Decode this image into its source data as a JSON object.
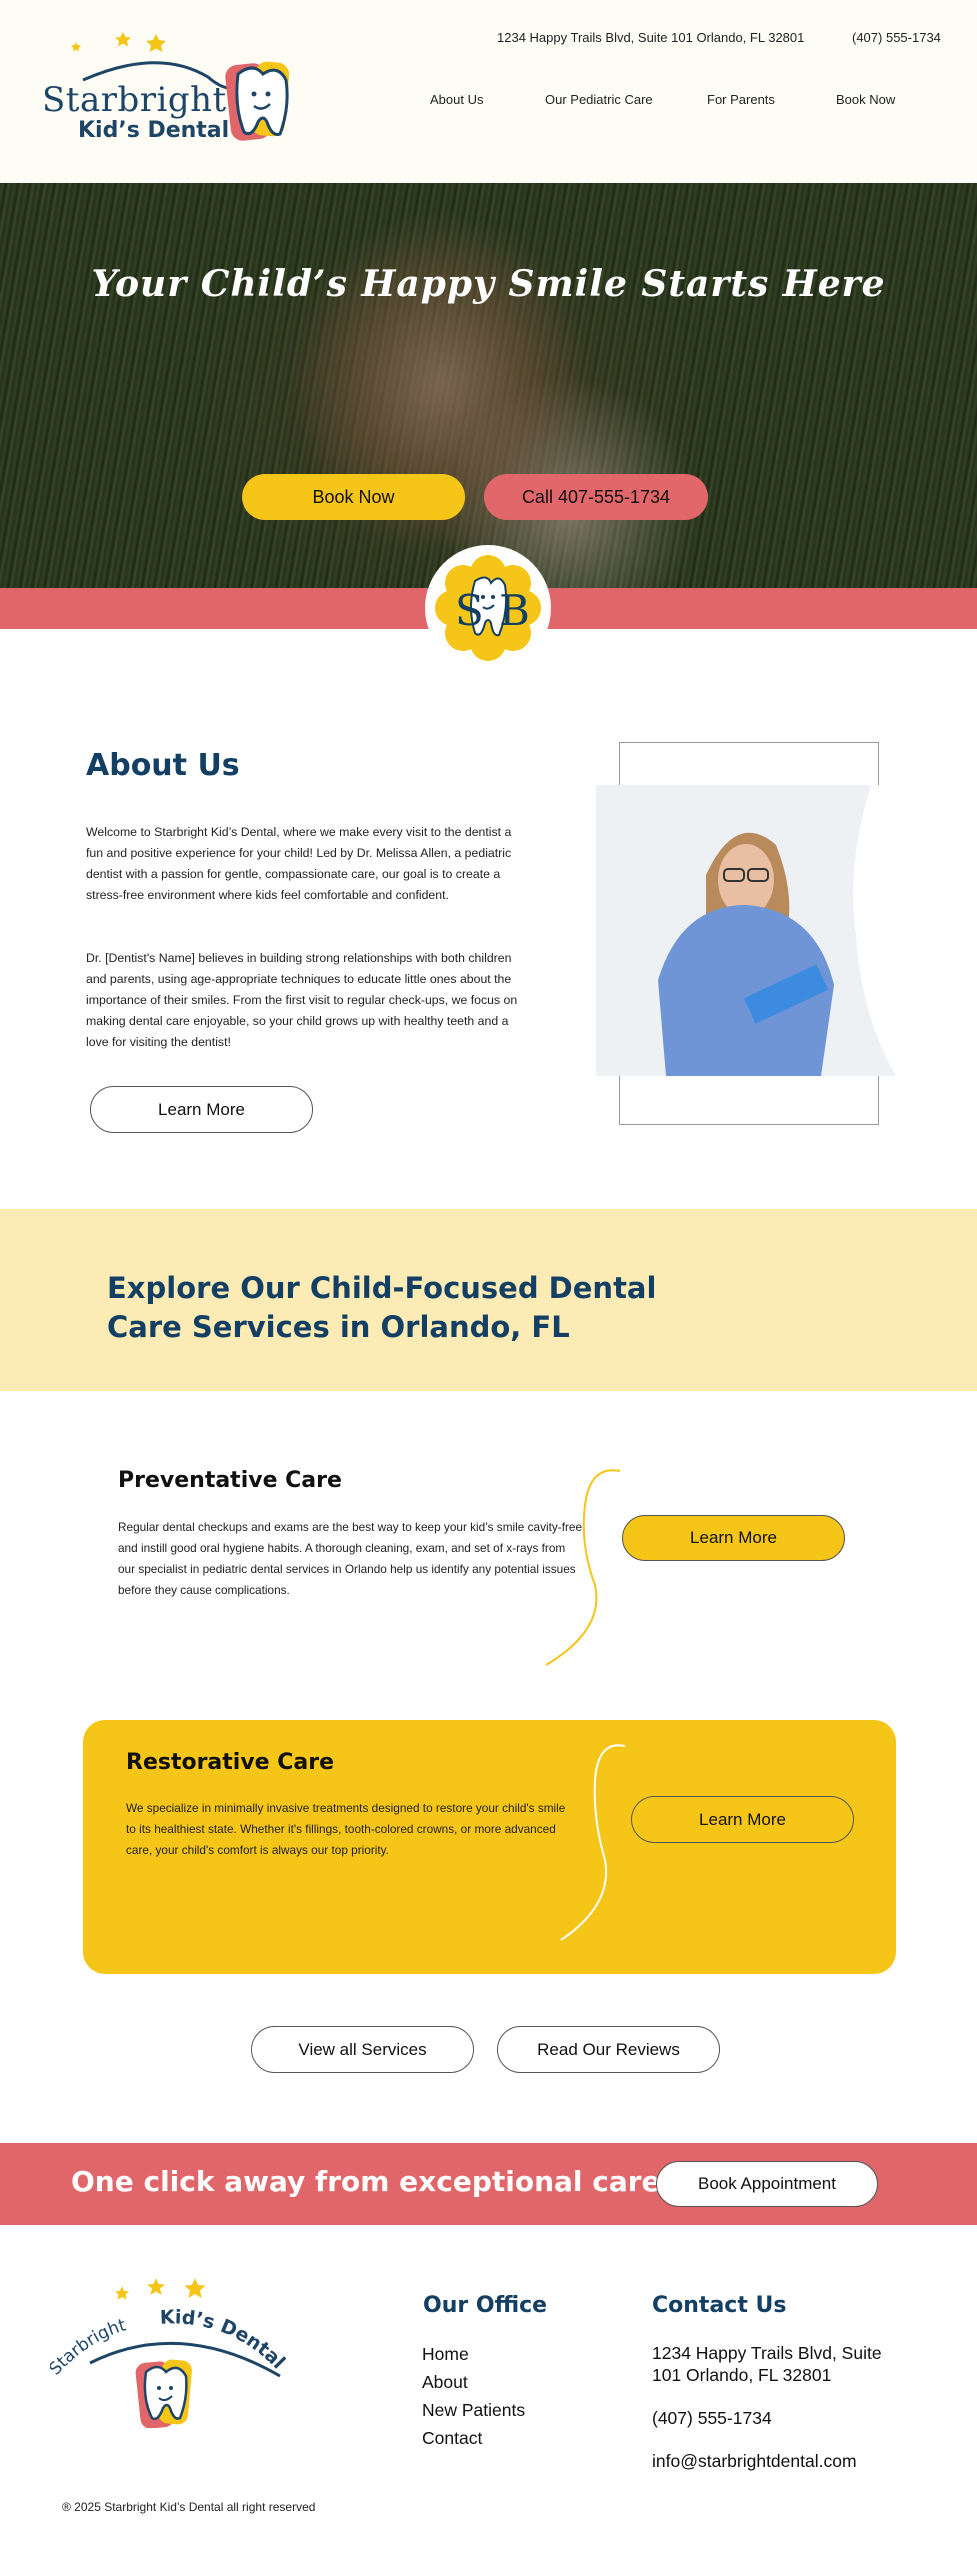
{
  "header": {
    "logo": {
      "line1": "Starbright",
      "line2": "Kid’s Dental"
    },
    "address": "1234 Happy Trails Blvd, Suite 101 Orlando, FL 32801",
    "phone": "(407) 555-1734",
    "nav": [
      {
        "label": "About Us"
      },
      {
        "label": "Our Pediatric Care"
      },
      {
        "label": "For Parents"
      },
      {
        "label": "Book Now"
      }
    ]
  },
  "hero": {
    "title": "Your Child’s Happy Smile Starts Here",
    "book_label": "Book Now",
    "call_label": "Call 407-555-1734",
    "badge_letters": {
      "left": "S",
      "right": "B"
    }
  },
  "about": {
    "title": "About Us",
    "paragraph1": "Welcome to Starbright Kid’s Dental, where we make every visit to the dentist a fun and positive experience for your child! Led by Dr. Melissa Allen, a pediatric dentist with a passion for gentle, compassionate care, our goal is to create a stress-free environment where kids feel comfortable and confident.",
    "paragraph2": "Dr. [Dentist's Name] believes in building strong relationships with both children and parents, using age-appropriate techniques to educate little ones about the importance of their smiles. From the first visit to regular check-ups, we focus on making dental care enjoyable, so your child grows up with healthy teeth and a love for visiting the dentist!",
    "button_label": "Learn More"
  },
  "services": {
    "banner_title": "Explore Our Child-Focused Dental Care Services in Orlando, FL",
    "items": [
      {
        "title": "Preventative Care",
        "text": "Regular dental checkups and exams are the best way to keep your kid’s smile cavity-free and instill good oral hygiene habits. A thorough cleaning, exam, and set of x-rays from our specialist in pediatric dental services in Orlando help us identify any potential issues before they cause complications.",
        "button_label": "Learn More"
      },
      {
        "title": "Restorative Care",
        "text": "We specialize in minimally invasive treatments designed to restore your child's smile to its healthiest state. Whether it's fillings, tooth-colored crowns, or more advanced care, your child's comfort is always our top priority.",
        "button_label": "Learn More"
      }
    ],
    "view_all_label": "View all Services",
    "reviews_label": "Read Our Reviews"
  },
  "cta": {
    "text": "One click away from exceptional care",
    "button_label": "Book Appointment"
  },
  "footer": {
    "logo": {
      "line1": "Starbright",
      "line2": "Kid’s Dental"
    },
    "office_heading": "Our Office",
    "office_links": [
      "Home",
      "About",
      "New Patients",
      "Contact"
    ],
    "contact_heading": "Contact Us",
    "address": "1234 Happy Trails Blvd, Suite 101 Orlando, FL 32801",
    "phone": "(407) 555-1734",
    "email": "info@starbrightdental.com",
    "copyright": "® 2025 Starbright Kid’s Dental all right reserved"
  },
  "colors": {
    "navy": "#123f63",
    "yellow": "#f5c518",
    "coral": "#e1666a",
    "cream": "#fcebb4",
    "header_bg": "#fdfdf6"
  }
}
